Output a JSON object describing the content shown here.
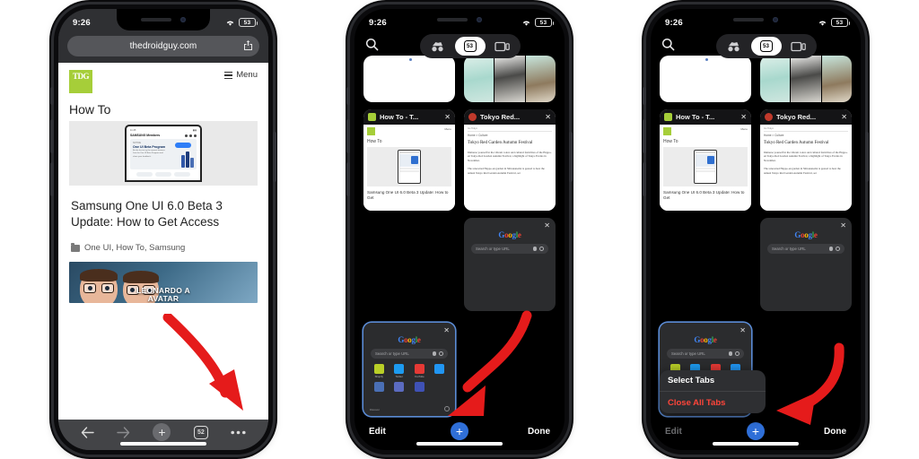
{
  "statusbar": {
    "time": "9:26",
    "battery": "53",
    "wifi_icon": "wifi-icon"
  },
  "phone1": {
    "name": "browser-view",
    "omnibox": {
      "url": "thedroidguy.com",
      "share_icon": "share-icon"
    },
    "site": {
      "logo_text": "TDG",
      "menu_label": "Menu",
      "category": "How To",
      "headline": "Samsung One UI 6.0 Beta 3 Update: How to Get Access",
      "tags": "One UI, How To, Samsung",
      "hero_phone": {
        "brand": "SAMSUNG Members",
        "card_label": "NOTICE",
        "card_title": "One UI Beta Program",
        "card_body": "Be the first to try the newest features. Join the One UI Beta Program and share your feedback.",
        "bubble_label": "Join now",
        "buttons": [
          "Benefits",
          "Registration",
          "How it works"
        ]
      },
      "thumb_caption_line1": "LEONARDO A",
      "thumb_caption_line2": "AVATAR"
    },
    "toolbar": {
      "back_icon": "back-arrow-icon",
      "forward_icon": "forward-arrow-icon",
      "new_tab_icon": "plus-icon",
      "tab_count": "52",
      "more_icon": "more-options-icon"
    }
  },
  "phone2": {
    "name": "tab-switcher-view",
    "top": {
      "search_icon": "search-icon",
      "incognito_icon": "incognito-icon",
      "tabs_count": "53",
      "desktop_icon": "desktop-tabs-icon"
    },
    "peek_tabs": [
      {
        "name": "blank-page-tab",
        "kind": "white"
      },
      {
        "name": "fashion-images-tab",
        "kind": "dress"
      }
    ],
    "cards": [
      {
        "name": "tab-card-how-to",
        "favicon": "tdg-favicon",
        "title": "How To - T...",
        "close_icon": "close-icon",
        "page": {
          "logo_text": "TDG",
          "menu_label": "Menu",
          "category": "How To",
          "caption": "Samsung One UI 6.0 Beta 3 Update: How to Get"
        }
      },
      {
        "name": "tab-card-tokyo-red",
        "favicon": "tokyo-favicon",
        "title": "Tokyo Red...",
        "close_icon": "close-icon",
        "page": {
          "topbar": "Go Tokyo",
          "breadcrumb": "Home > Culture",
          "headline": "Tokyo Red Garden Autumn Festival",
          "para1": "Immerse yourself in the vibrant colors and cultural festivities of the Happo-en Tokyo Red Garden Autumn Festival, a highlight of Tokyo Events in November.",
          "para2": "The renowned Happo-en garden in Shirokanedai is geared to host the annual Tokyo Red Garden Autumn Festival, set"
        }
      }
    ],
    "google_cards": [
      {
        "name": "google-tab-card-right",
        "close_icon": "close-icon",
        "logo": "Google",
        "search_placeholder": "Search or type URL",
        "mic_icon": "microphone-icon",
        "lens_icon": "lens-icon",
        "selected": false,
        "shortcuts": []
      },
      {
        "name": "google-tab-card-selected",
        "close_icon": "close-icon",
        "logo": "Google",
        "search_placeholder": "Search or type URL",
        "mic_icon": "microphone-icon",
        "lens_icon": "lens-icon",
        "selected": true,
        "discover_label": "Discover",
        "settings_icon": "settings-icon",
        "shortcuts": [
          {
            "label": "Shopify",
            "color": "#b9cf27"
          },
          {
            "label": "Twitter",
            "color": "#1d9bf0"
          },
          {
            "label": "YouTube",
            "color": "#e53935"
          },
          {
            "label": "",
            "color": "#2196f3"
          }
        ]
      }
    ],
    "bottom": {
      "edit_label": "Edit",
      "add_icon": "plus-icon",
      "done_label": "Done"
    }
  },
  "phone3": {
    "name": "tab-switcher-with-menu",
    "bottom": {
      "edit_label": "Edit",
      "add_icon": "plus-icon",
      "done_label": "Done"
    },
    "context_menu": {
      "name": "tab-options-menu",
      "items": [
        {
          "label": "Select Tabs",
          "destructive": false
        },
        {
          "label": "Close All Tabs",
          "destructive": true
        }
      ]
    }
  },
  "annotations": {
    "arrow_color": "#e51b1b",
    "arrows": [
      {
        "name": "arrow-to-more-options",
        "target": "more-options-icon"
      },
      {
        "name": "arrow-to-edit",
        "target": "edit-button"
      },
      {
        "name": "arrow-to-close-all-tabs",
        "target": "close-all-tabs-item"
      }
    ]
  }
}
